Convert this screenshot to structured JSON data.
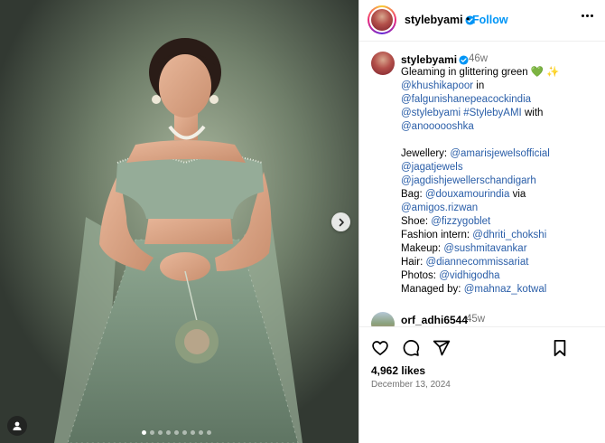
{
  "post": {
    "username": "stylebyami",
    "follow_label": "Follow",
    "separator": "•",
    "caption_time": "46w",
    "caption_lines": [
      {
        "parts": [
          {
            "t": "Gleaming in glittering green 💚 ✨",
            "m": false
          }
        ]
      },
      {
        "parts": [
          {
            "t": "@khushikapoor",
            "m": true
          },
          {
            "t": " in",
            "m": false
          }
        ]
      },
      {
        "parts": [
          {
            "t": "@falgunishanepeacockindia",
            "m": true
          }
        ]
      },
      {
        "parts": [
          {
            "t": "@stylebyami",
            "m": true
          },
          {
            "t": " ",
            "m": false
          },
          {
            "t": "#StylebyAMI",
            "m": true
          },
          {
            "t": " with",
            "m": false
          }
        ]
      },
      {
        "parts": [
          {
            "t": "@anoooooshka",
            "m": true
          }
        ]
      },
      {
        "gap": true
      },
      {
        "parts": [
          {
            "t": "Jewellery: ",
            "m": false
          },
          {
            "t": "@amarisjewelsofficial",
            "m": true
          }
        ]
      },
      {
        "parts": [
          {
            "t": "@jagatjewels",
            "m": true
          }
        ]
      },
      {
        "parts": [
          {
            "t": "@jagdishjewellerschandigarh",
            "m": true
          }
        ]
      },
      {
        "parts": [
          {
            "t": "Bag: ",
            "m": false
          },
          {
            "t": "@douxamourindia",
            "m": true
          },
          {
            "t": " via",
            "m": false
          }
        ]
      },
      {
        "parts": [
          {
            "t": "@amigos.rizwan",
            "m": true
          }
        ]
      },
      {
        "parts": [
          {
            "t": "Shoe: ",
            "m": false
          },
          {
            "t": "@fizzygoblet",
            "m": true
          }
        ]
      },
      {
        "parts": [
          {
            "t": "Fashion intern: ",
            "m": false
          },
          {
            "t": "@dhriti_chokshi",
            "m": true
          }
        ]
      },
      {
        "parts": [
          {
            "t": "Makeup: ",
            "m": false
          },
          {
            "t": "@sushmitavankar",
            "m": true
          }
        ]
      },
      {
        "parts": [
          {
            "t": "Hair: ",
            "m": false
          },
          {
            "t": "@diannecommissariat",
            "m": true
          }
        ]
      },
      {
        "parts": [
          {
            "t": "Photos: ",
            "m": false
          },
          {
            "t": "@vidhigodha",
            "m": true
          }
        ]
      },
      {
        "parts": [
          {
            "t": "Managed by: ",
            "m": false
          },
          {
            "t": "@mahnaz_kotwal",
            "m": true
          }
        ]
      }
    ],
    "comment": {
      "username": "orf_adhi6544",
      "time": "45w"
    },
    "likes": "4,962 likes",
    "date": "December 13, 2024",
    "carousel": {
      "count": 9,
      "active_index": 0
    },
    "colors": {
      "accent": "#0095f6",
      "mention": "#2a5ea8",
      "verified": "#0095f6",
      "muted": "#737373"
    },
    "icons": [
      "verified-badge-icon",
      "more-options-icon",
      "heart-icon",
      "comment-icon",
      "share-icon",
      "bookmark-icon",
      "chevron-right-icon",
      "user-tag-icon"
    ]
  }
}
